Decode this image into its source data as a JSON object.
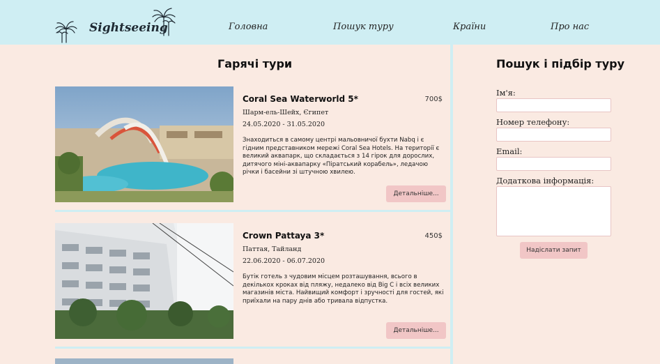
{
  "header": {
    "logo_text": "Sightseeing",
    "nav": [
      "Головна",
      "Пошук туру",
      "Країни",
      "Про нас"
    ]
  },
  "hot_tours": {
    "title": "Гарячі тури",
    "cards": [
      {
        "name": "Coral Sea Waterworld 5*",
        "price": "700$",
        "location": "Шарм-ель-Шейх, Єгипет",
        "dates": "24.05.2020 - 31.05.2020",
        "description": "Знаходиться в самому центрі мальовничої бухти Nabq і є гідним представником мережі Coral Sea Hotels. На території є великий аквапарк, що складається з 14 гірок для дорослих, дитячого міні-аквапарку «Піратський корабель», ледачою річки і басейни зі штучною хвилею.",
        "button": "Детальніше..."
      },
      {
        "name": "Crown Pattaya 3*",
        "price": "450$",
        "location": "Паттая, Тайланд",
        "dates": "22.06.2020 - 06.07.2020",
        "description": "Бутік готель з чудовим місцем розташування, всього в декількох кроках від пляжу, недалеко від Big C і всіх великих магазинів міста. Найвищий комфорт і зручності для гостей, які приїхали на пару днів або тривала відпустка.",
        "button": "Детальніше..."
      }
    ]
  },
  "search_form": {
    "title": "Пошук і підбір туру",
    "name_label": "Ім'я:",
    "phone_label": "Номер телефону:",
    "email_label": "Email:",
    "info_label": "Додаткова інформація:",
    "submit": "Надіслати запит"
  }
}
